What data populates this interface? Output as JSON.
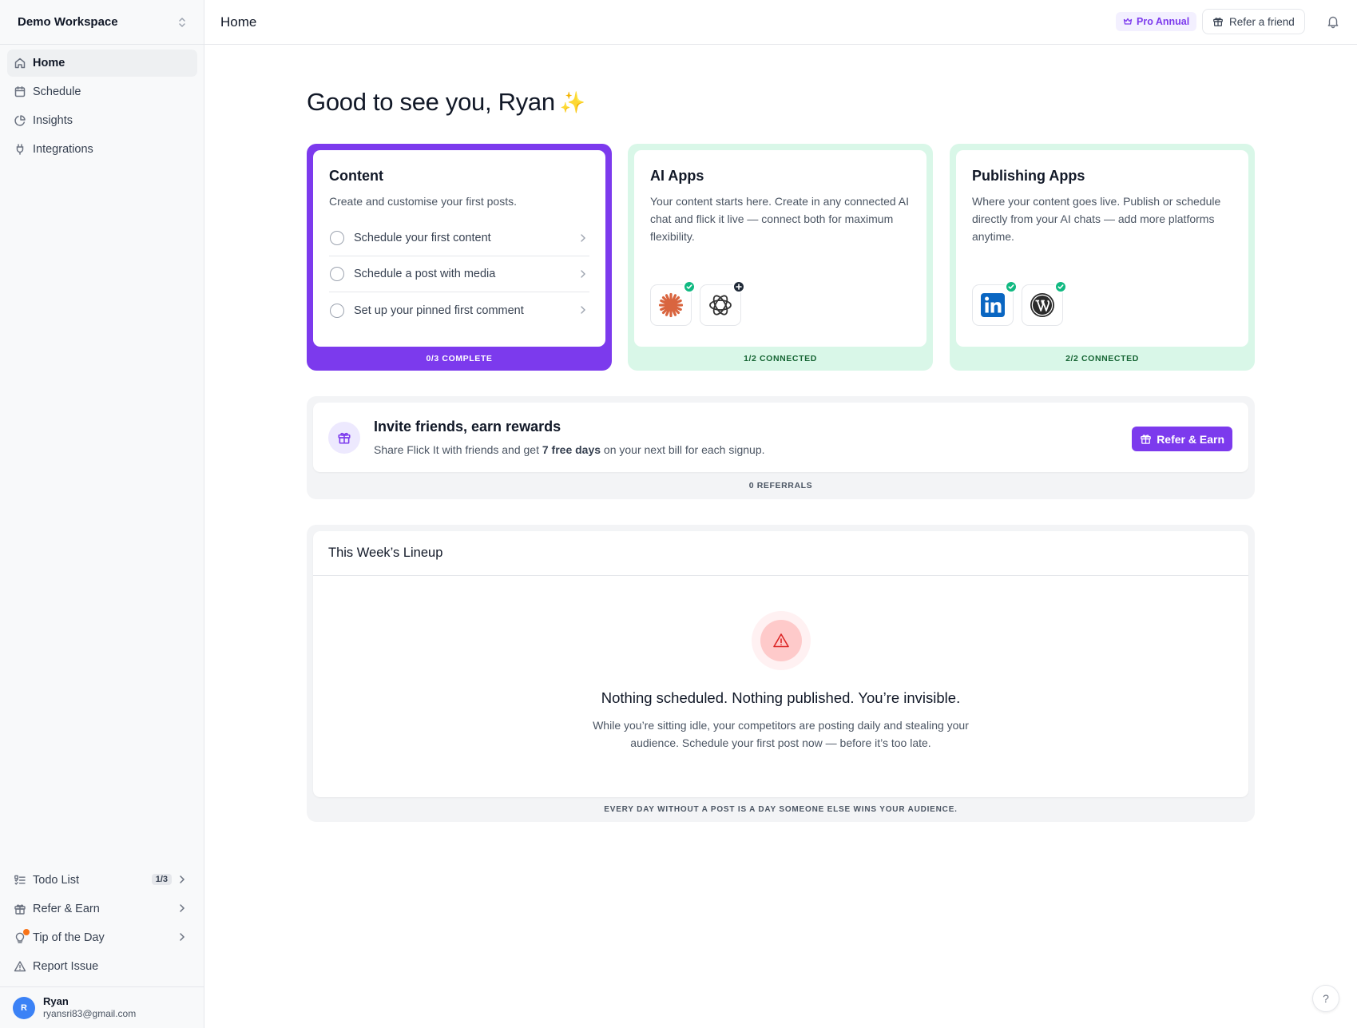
{
  "sidebar": {
    "workspace": "Demo Workspace",
    "nav": [
      {
        "label": "Home",
        "icon": "home-icon",
        "active": true
      },
      {
        "label": "Schedule",
        "icon": "calendar-icon"
      },
      {
        "label": "Insights",
        "icon": "chart-pie-icon"
      },
      {
        "label": "Integrations",
        "icon": "plug-icon"
      }
    ],
    "bottom": {
      "todo": {
        "label": "Todo List",
        "badge": "1/3",
        "icon": "list-checks-icon"
      },
      "refer": {
        "label": "Refer & Earn",
        "icon": "gift-icon"
      },
      "tip": {
        "label": "Tip of the Day",
        "icon": "lightbulb-icon"
      },
      "report": {
        "label": "Report Issue",
        "icon": "warning-triangle-icon"
      }
    },
    "user": {
      "initial": "R",
      "name": "Ryan",
      "email": "ryansri83@gmail.com"
    }
  },
  "header": {
    "title": "Home",
    "plan_badge": "Pro Annual",
    "refer_button": "Refer a friend"
  },
  "main": {
    "greeting": "Good to see you, Ryan",
    "greeting_emoji": "✨",
    "cards": {
      "content": {
        "title": "Content",
        "description": "Create and customise your first posts.",
        "tasks": [
          "Schedule your first content",
          "Schedule a post with media",
          "Set up your pinned first comment"
        ],
        "footer": "0/3 COMPLETE"
      },
      "ai_apps": {
        "title": "AI Apps",
        "description": "Your content starts here. Create in any connected AI chat and flick it live — connect both for maximum flexibility.",
        "apps": [
          {
            "icon": "claude-icon",
            "status": "connected"
          },
          {
            "icon": "openai-icon",
            "status": "add"
          }
        ],
        "footer": "1/2 CONNECTED"
      },
      "publishing_apps": {
        "title": "Publishing Apps",
        "description": "Where your content goes live. Publish or schedule directly from your AI chats — add more platforms anytime.",
        "apps": [
          {
            "icon": "linkedin-icon",
            "status": "connected"
          },
          {
            "icon": "wordpress-icon",
            "status": "connected"
          }
        ],
        "footer": "2/2 CONNECTED"
      }
    },
    "invite": {
      "title": "Invite friends, earn rewards",
      "desc_before": "Share Flick It with friends and get ",
      "desc_bold": "7 free days",
      "desc_after": " on your next bill for each signup.",
      "button": "Refer & Earn",
      "footer": "0 REFERRALS"
    },
    "lineup": {
      "title": "This Week’s Lineup",
      "empty_title": "Nothing scheduled. Nothing published. You’re invisible.",
      "empty_desc": "While you’re sitting idle, your competitors are posting daily and stealing your audience. Schedule your first post now — before it’s too late.",
      "footer": "EVERY DAY WITHOUT A POST IS A DAY SOMEONE ELSE WINS YOUR AUDIENCE."
    },
    "help": "?"
  },
  "colors": {
    "accent": "#7c3aed",
    "mint": "#d9f7e8",
    "success": "#10b981",
    "danger": "#dc2626"
  }
}
